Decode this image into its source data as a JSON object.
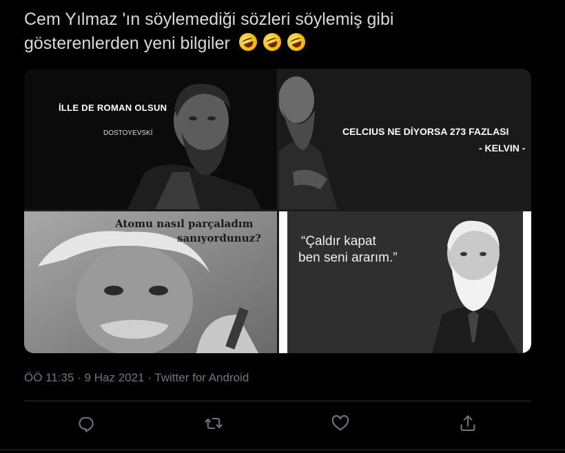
{
  "tweet": {
    "text_line1": "Cem Yılmaz 'ın söylemediği sözleri söylemiş gibi",
    "text_line2": "gösterenlerden yeni bilgiler",
    "emoji": [
      "rolling-on-floor-laughing-icon",
      "rolling-on-floor-laughing-icon",
      "rolling-on-floor-laughing-icon"
    ]
  },
  "media": {
    "tile1": {
      "caption_main": "İLLE DE ROMAN OLSUN",
      "caption_author": "DOSTOYEVSKİ"
    },
    "tile2": {
      "caption_main": "CELCIUS NE DİYORSA 273 FAZLASI",
      "caption_author": "- KELVIN -"
    },
    "tile3": {
      "caption_line1": "Atomu nasıl parçaladım",
      "caption_line2": "sanıyordunuz?"
    },
    "tile4": {
      "caption_line1": "“Çaldır kapat",
      "caption_line2": "ben seni ararım.”"
    }
  },
  "meta": {
    "timestamp": "ÖÖ 11:35 · 9 Haz 2021 · Twitter for Android"
  },
  "actions": [
    "reply-icon",
    "retweet-icon",
    "like-icon",
    "share-icon"
  ],
  "colors": {
    "background": "#000000",
    "text": "#d9d9d9",
    "muted": "#6e767d",
    "divider": "#2f3336"
  }
}
